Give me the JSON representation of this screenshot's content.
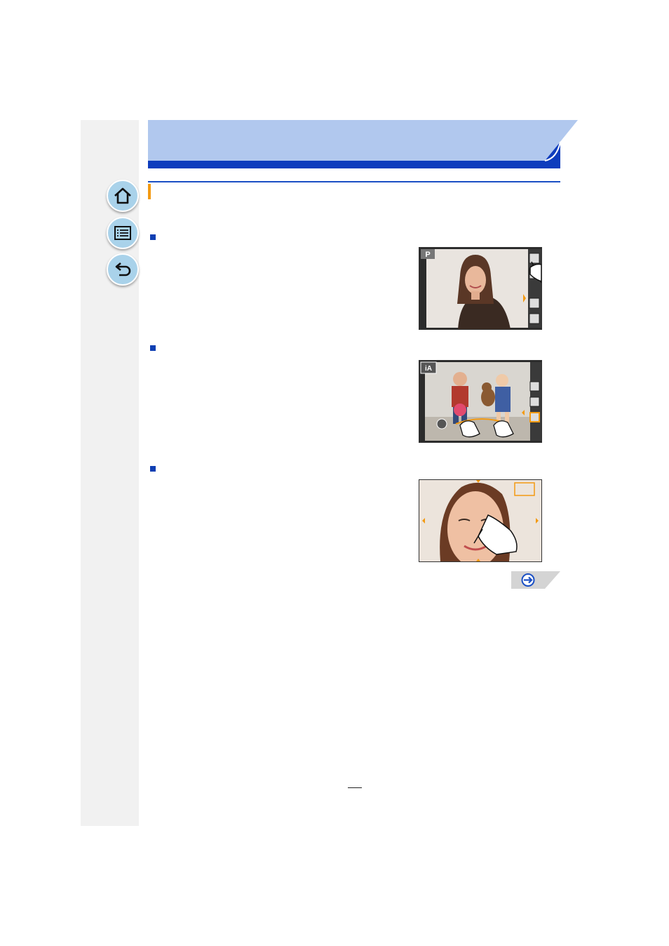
{
  "sidebar": {
    "buttons": [
      {
        "name": "home",
        "icon": "home-icon"
      },
      {
        "name": "contents",
        "icon": "list-icon"
      },
      {
        "name": "back",
        "icon": "return-arrow-icon"
      }
    ]
  },
  "illustrations": {
    "touch_panel": {
      "mode_label": "P"
    },
    "touch_slide": {
      "mode_label": "iA"
    },
    "touch_pinch": {}
  },
  "colors": {
    "header_light": "#b1c8ee",
    "header_dark": "#0e3dbd",
    "accent_orange": "#f39a12",
    "sidebar_bg": "#f1f1f1",
    "nav_button": "#a9d2ea",
    "bullet": "#0f3fb3"
  },
  "next_page": {
    "icon": "arrow-right-circle-icon"
  }
}
